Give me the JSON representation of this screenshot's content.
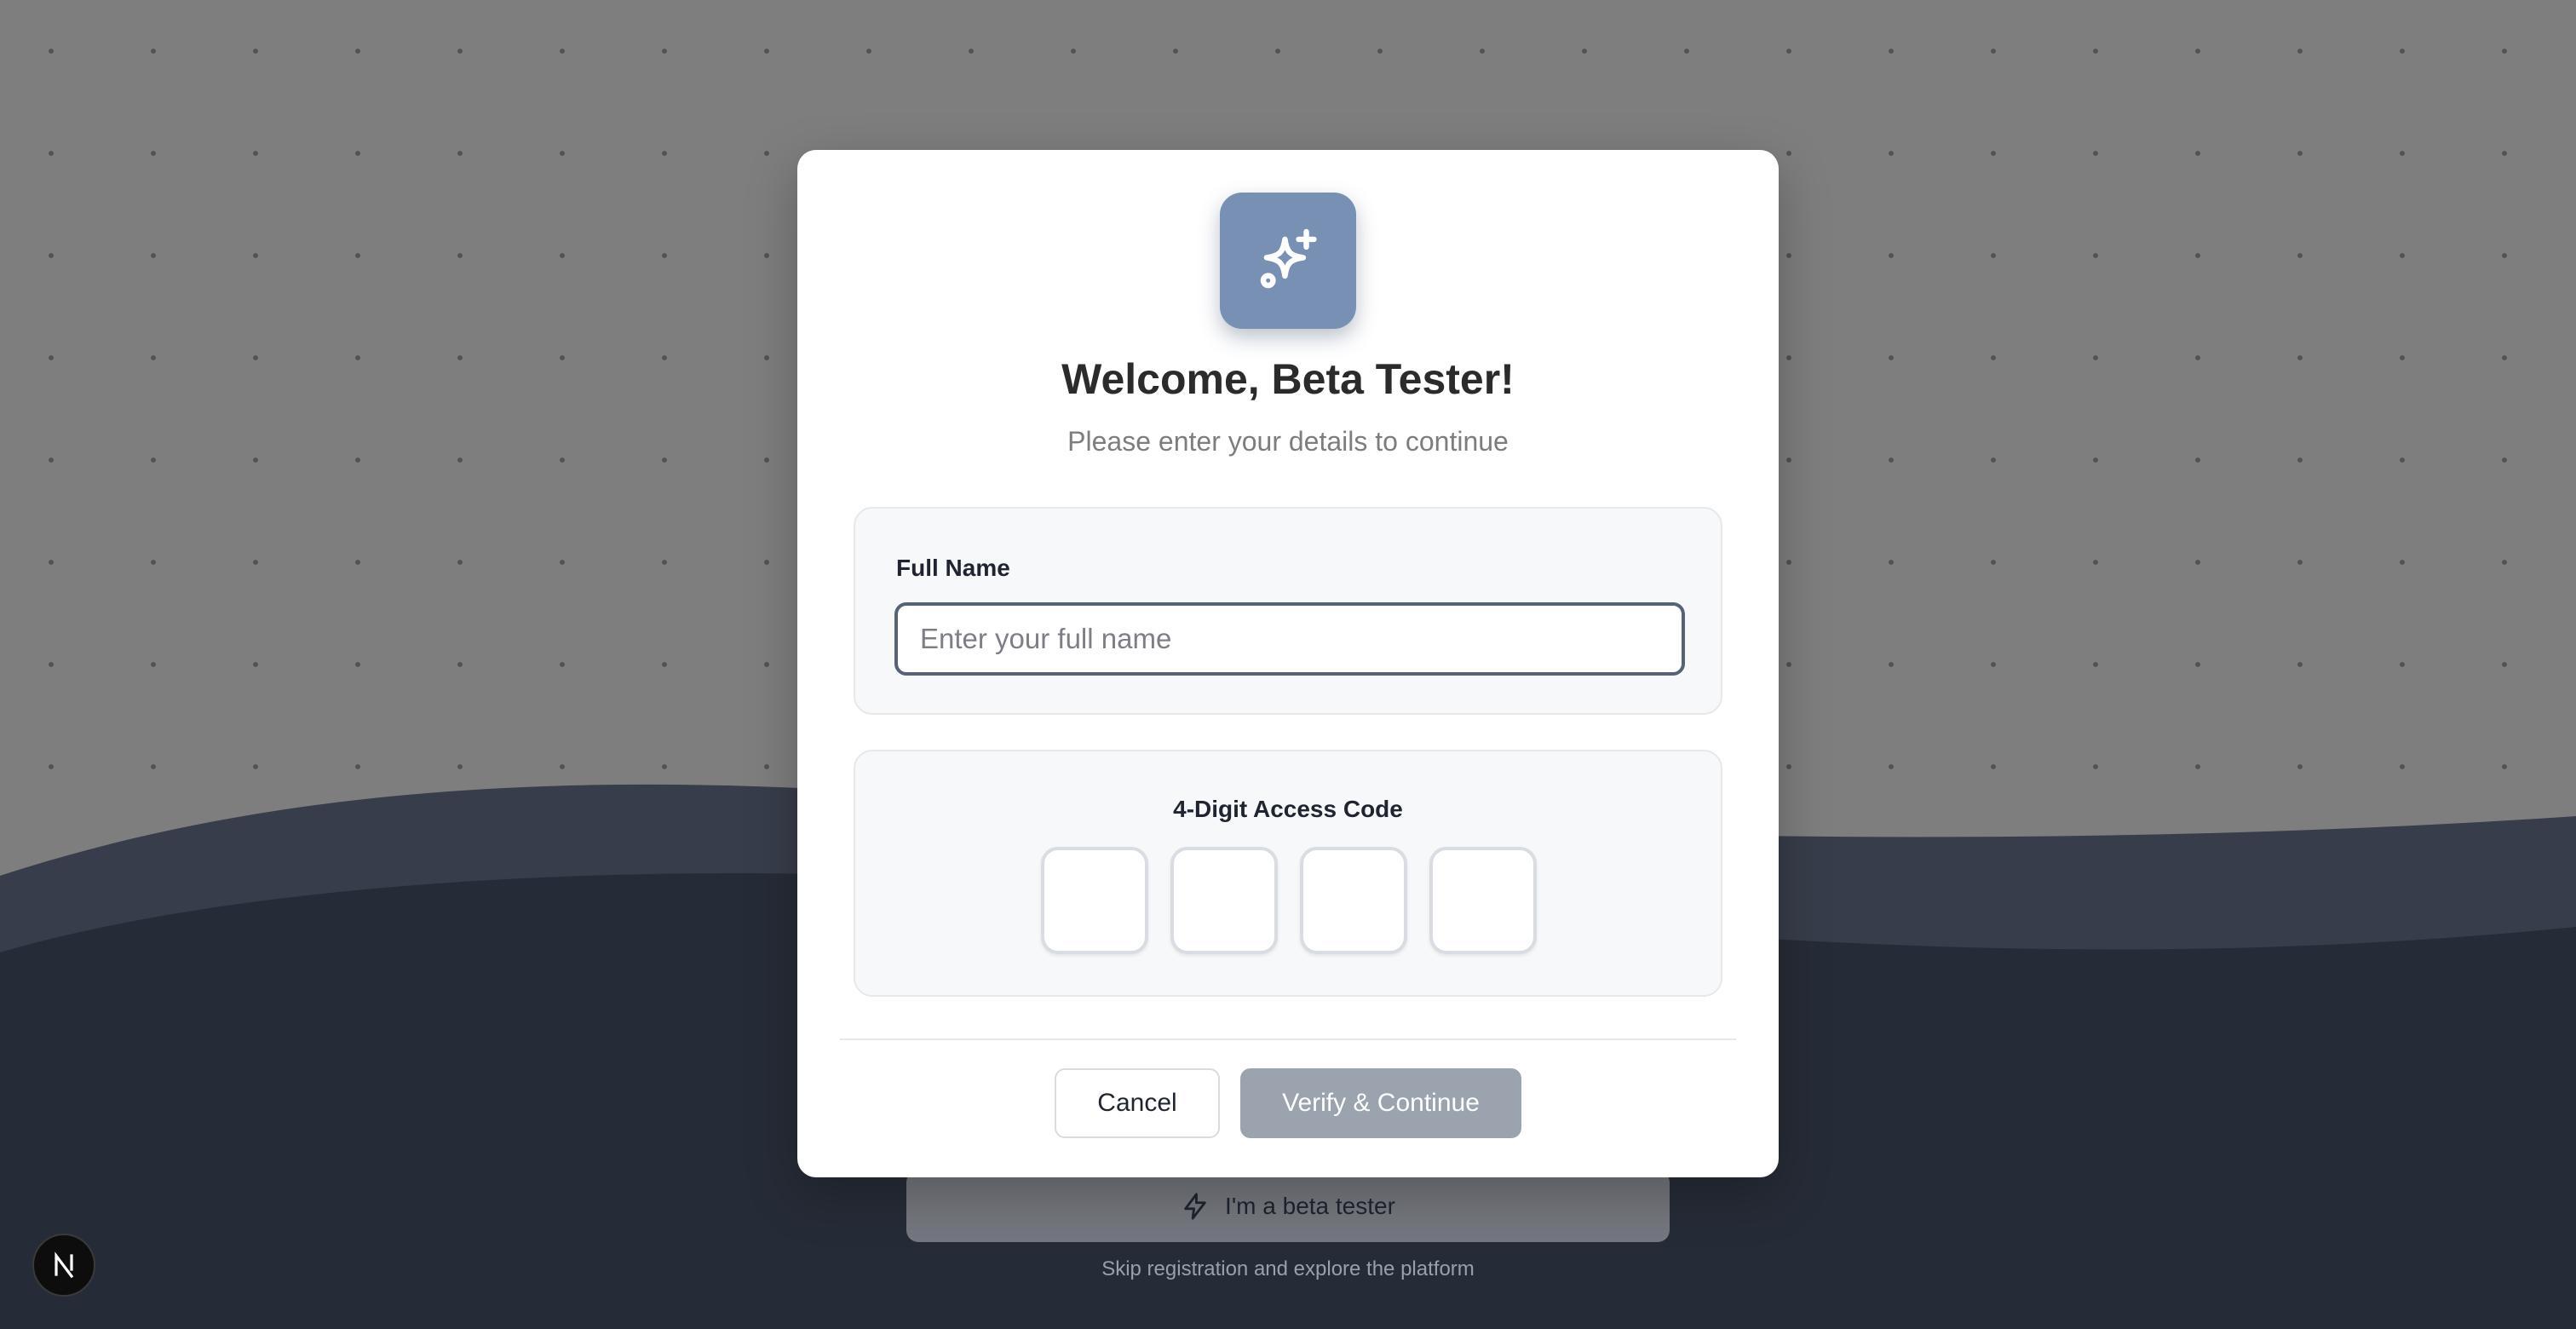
{
  "modal": {
    "title": "Welcome, Beta Tester!",
    "subtitle": "Please enter your details to continue",
    "logo_icon": "sparkles-icon",
    "full_name": {
      "label": "Full Name",
      "placeholder": "Enter your full name",
      "value": ""
    },
    "access_code": {
      "label": "4-Digit Access Code",
      "digits": [
        "",
        "",
        "",
        ""
      ]
    },
    "cancel_label": "Cancel",
    "verify_label": "Verify & Continue"
  },
  "background": {
    "beta_button_label": "I'm a beta tester",
    "beta_button_icon": "zap-icon",
    "skip_text": "Skip registration and explore the platform",
    "badge_icon": "nextjs-n-icon"
  },
  "colors": {
    "accent_tile": "#7890b3",
    "verify_disabled": "#9aa3ae",
    "input_focus_border": "#566275",
    "wave_light": "#373d4a",
    "wave_dark": "#262c37"
  }
}
